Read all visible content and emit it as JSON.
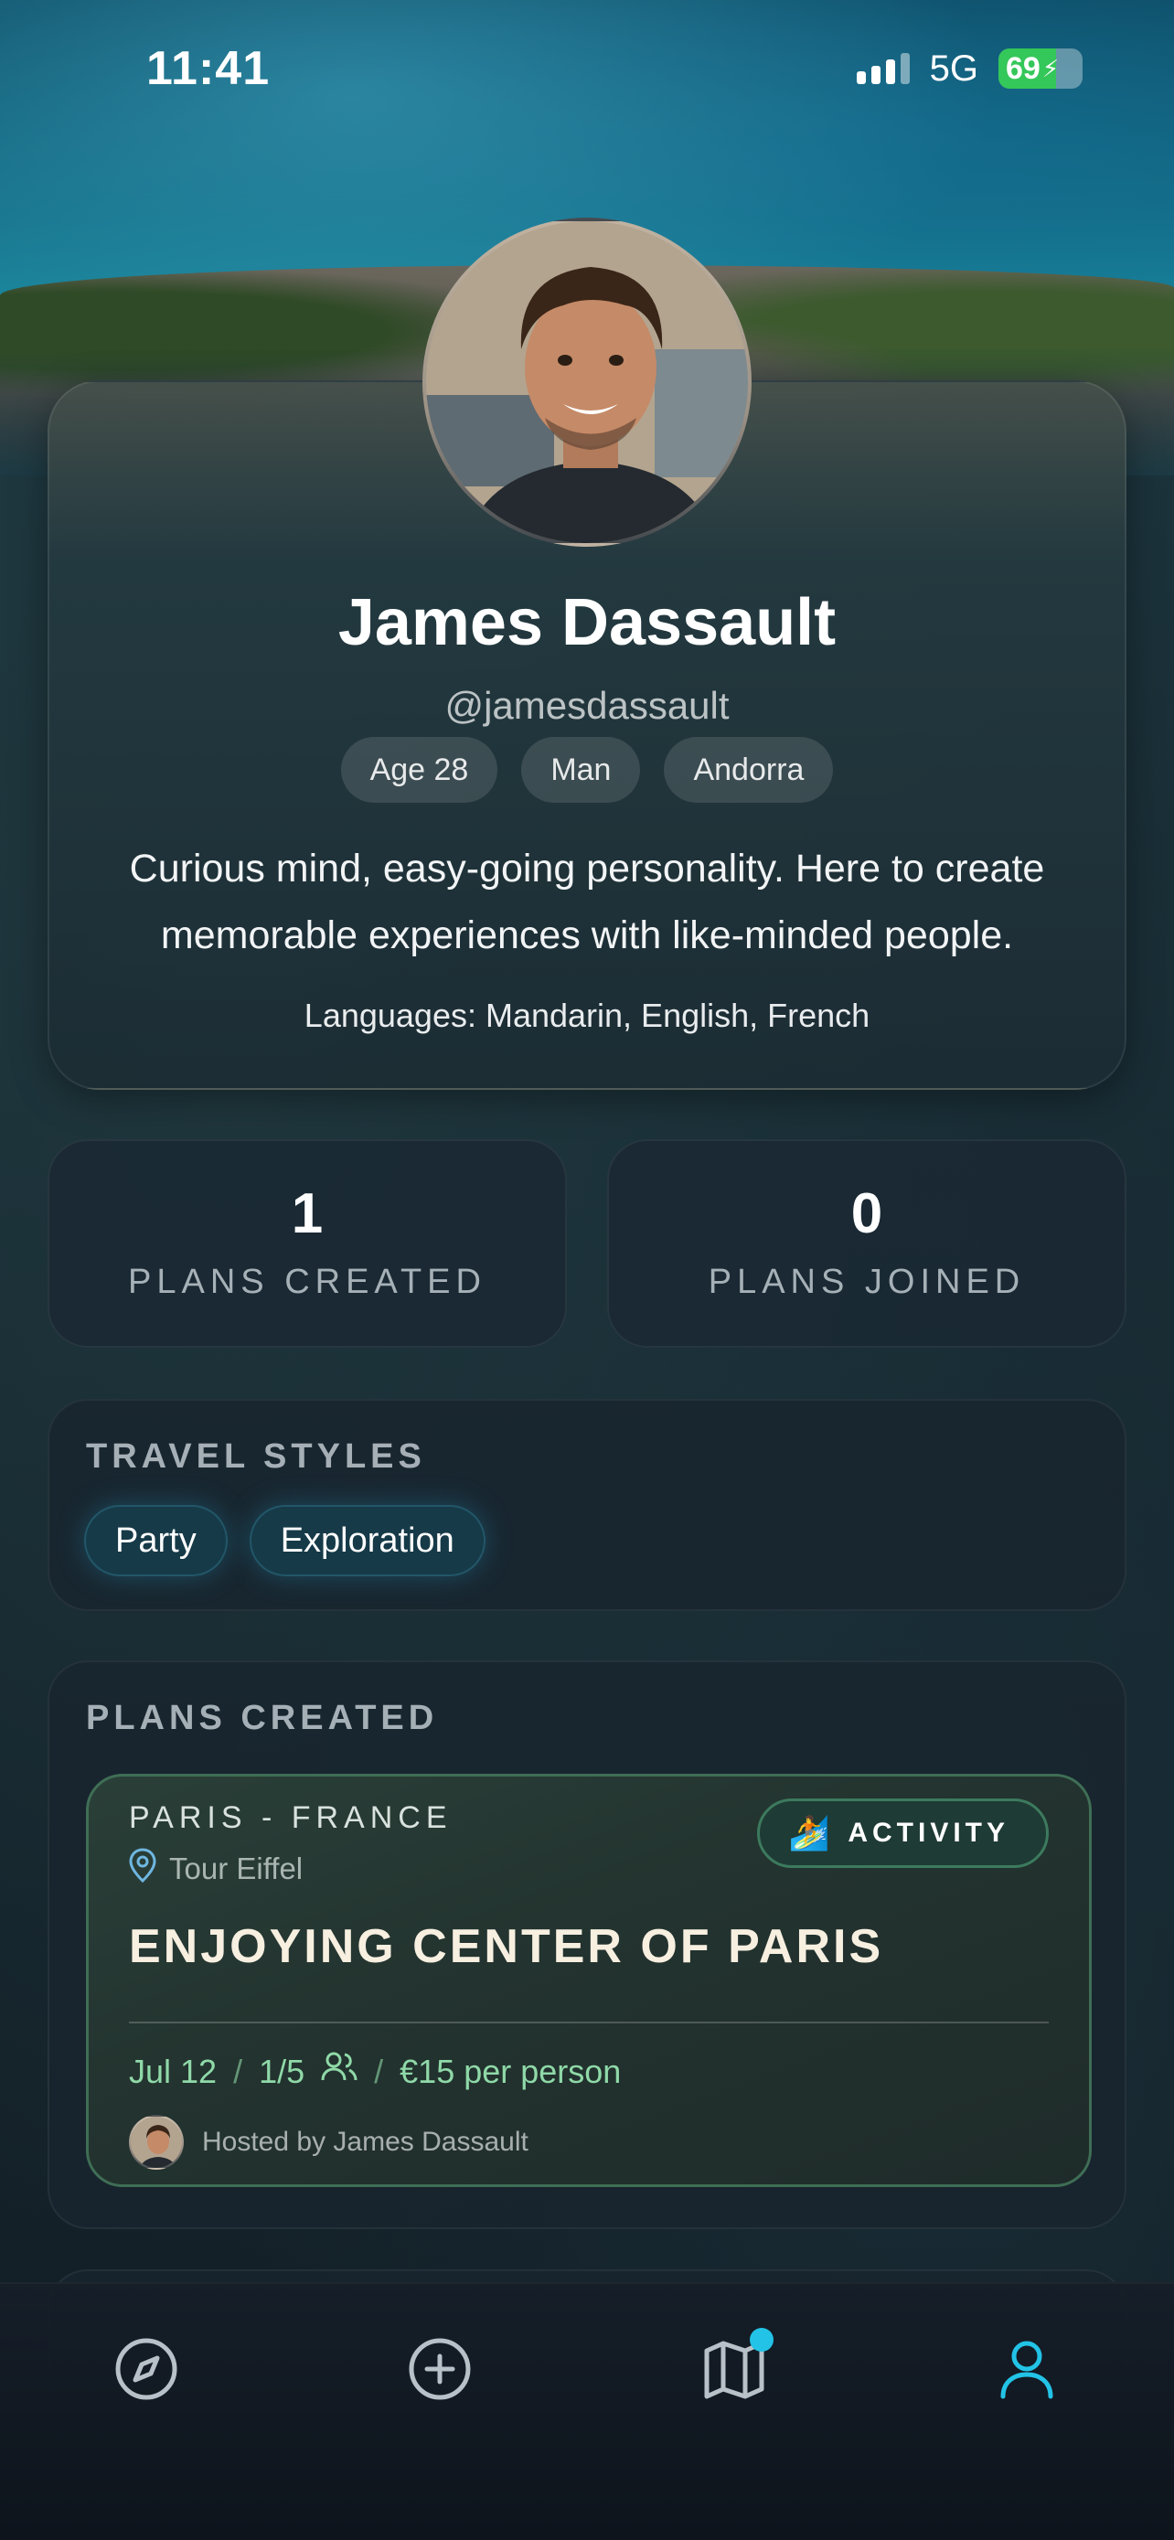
{
  "status_bar": {
    "time": "11:41",
    "network": "5G",
    "battery_level": "69",
    "battery_percent": 69
  },
  "profile": {
    "name": "James Dassault",
    "handle": "@jamesdassault",
    "chips": [
      "Age 28",
      "Man",
      "Andorra"
    ],
    "bio": "Curious mind, easy-going personality. Here to create memorable experiences with like-minded people.",
    "languages": "Languages: Mandarin, English, French"
  },
  "stats": {
    "plans_created_value": "1",
    "plans_created_label": "PLANS CREATED",
    "plans_joined_value": "0",
    "plans_joined_label": "PLANS JOINED"
  },
  "travel_styles": {
    "title": "TRAVEL STYLES",
    "items": [
      "Party",
      "Exploration"
    ]
  },
  "plans_created": {
    "title": "PLANS CREATED",
    "plans": [
      {
        "location": "PARIS - FRANCE",
        "place": "Tour Eiffel",
        "badge_emoji": "🏄",
        "badge_label": "ACTIVITY",
        "title": "ENJOYING CENTER OF PARIS",
        "date": "Jul 12",
        "participants": "1/5",
        "price": "€15 per person",
        "host": "Hosted by James Dassault"
      }
    ]
  },
  "tab_bar": {
    "tabs": [
      {
        "icon": "compass-icon",
        "active": false
      },
      {
        "icon": "plus-circle-icon",
        "active": false
      },
      {
        "icon": "map-icon",
        "active": false,
        "notification": true
      },
      {
        "icon": "user-icon",
        "active": true
      }
    ],
    "active_color": "#22c3e6",
    "inactive_color": "#b8c0c8"
  },
  "colors": {
    "accent": "#22c3e6",
    "plan_meta": "#8fd9a8",
    "plan_border": "#3f6e55"
  }
}
